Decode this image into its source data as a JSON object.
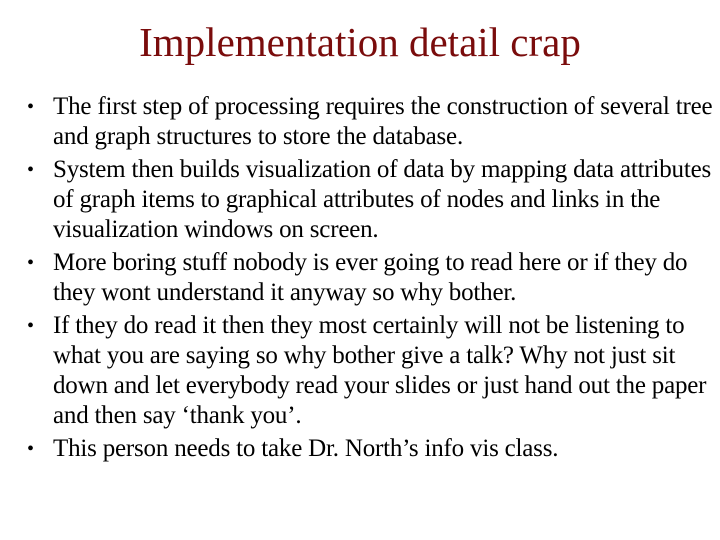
{
  "slide": {
    "title": "Implementation detail crap",
    "title_color": "#7a0c0c",
    "bullet_glyph": "•",
    "bullets": [
      "The first step of processing requires the construction of several tree and graph structures to store the database.",
      "System then builds visualization of data by mapping data attributes of graph items to graphical attributes of nodes and links in the visualization windows on screen.",
      "More boring stuff nobody is ever going to read here or if they do they wont understand it anyway so why bother.",
      "If they do read it then they most certainly will not be listening to what you are saying so why bother give a talk? Why not just sit down and let everybody read your slides or just hand out the paper and then say ‘thank you’.",
      "This person needs to take Dr. North’s info vis class."
    ]
  }
}
